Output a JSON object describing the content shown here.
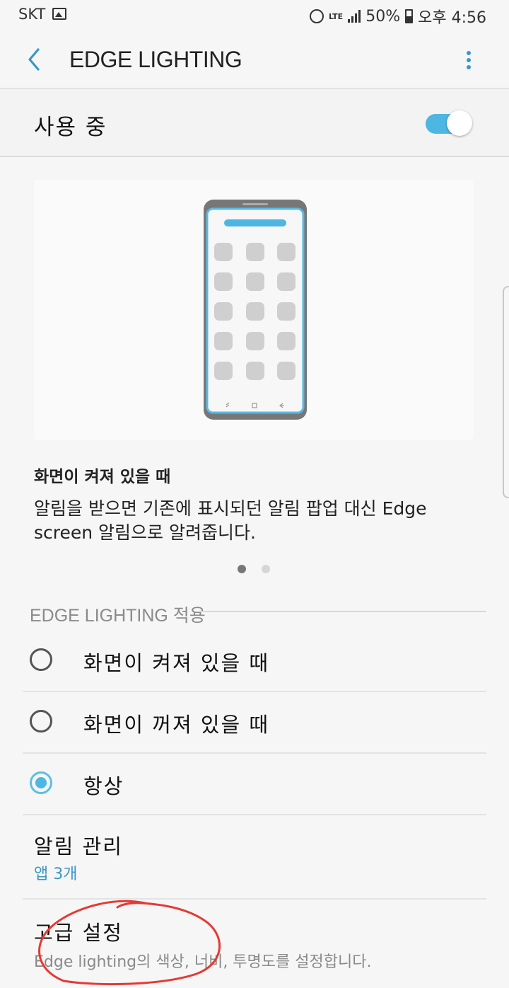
{
  "status_bar": {
    "carrier": "SKT",
    "network": "LTE",
    "battery": "50%",
    "time": "오후 4:56",
    "icons": [
      "gallery-icon",
      "alarm-icon",
      "signal-icon",
      "battery-icon"
    ]
  },
  "app_bar": {
    "title": "EDGE LIGHTING",
    "back_icon": "back-arrow-icon",
    "more_icon": "more-options-icon"
  },
  "master_switch": {
    "label": "사용 중",
    "on": true
  },
  "preview": {
    "title": "화면이 켜져 있을 때",
    "description": "알림을 받으면 기존에 표시되던 알림 팝업 대신 Edge screen 알림으로 알려줍니다.",
    "page_count": 2,
    "active_page": 1
  },
  "apply_section": {
    "header": "EDGE LIGHTING 적용",
    "options": [
      {
        "label": "화면이 켜져 있을 때",
        "selected": false
      },
      {
        "label": "화면이 꺼져 있을 때",
        "selected": false
      },
      {
        "label": "항상",
        "selected": true
      }
    ]
  },
  "menu": {
    "manage": {
      "title": "알림 관리",
      "subtitle": "앱 3개"
    },
    "advanced": {
      "title": "고급 설정",
      "subtitle": "Edge lighting의 색상, 너비, 투명도를 설정합니다."
    }
  },
  "colors": {
    "accent": "#4db6e2",
    "link": "#3a97c7",
    "annotation": "#e53935"
  }
}
